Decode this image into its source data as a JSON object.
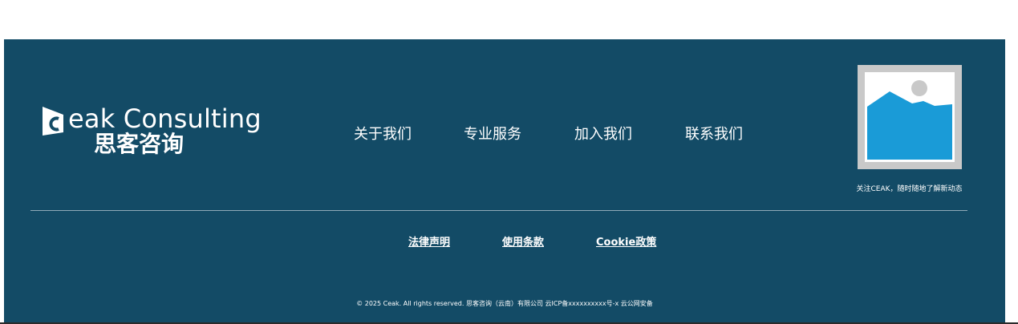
{
  "brand": {
    "name_en": "eak Consulting",
    "name_cn": "思客咨询",
    "colors": {
      "footer_bg": "#134b66",
      "image_accent": "#1a9bd7",
      "text": "#ffffff"
    }
  },
  "nav": {
    "items": [
      {
        "label": "关于我们"
      },
      {
        "label": "专业服务"
      },
      {
        "label": "加入我们"
      },
      {
        "label": "联系我们"
      }
    ]
  },
  "qr": {
    "icon": "image-placeholder-icon",
    "caption": "关注CEAK，随时随地了解新动态"
  },
  "legal_links": [
    {
      "label": "法律声明"
    },
    {
      "label": "使用条款"
    },
    {
      "label": "Cookie政策"
    }
  ],
  "copyright": "© 2025 Ceak. All rights reserved. 思客咨询（云南）有限公司 云ICP备xxxxxxxxxx号-x 云公网安备"
}
